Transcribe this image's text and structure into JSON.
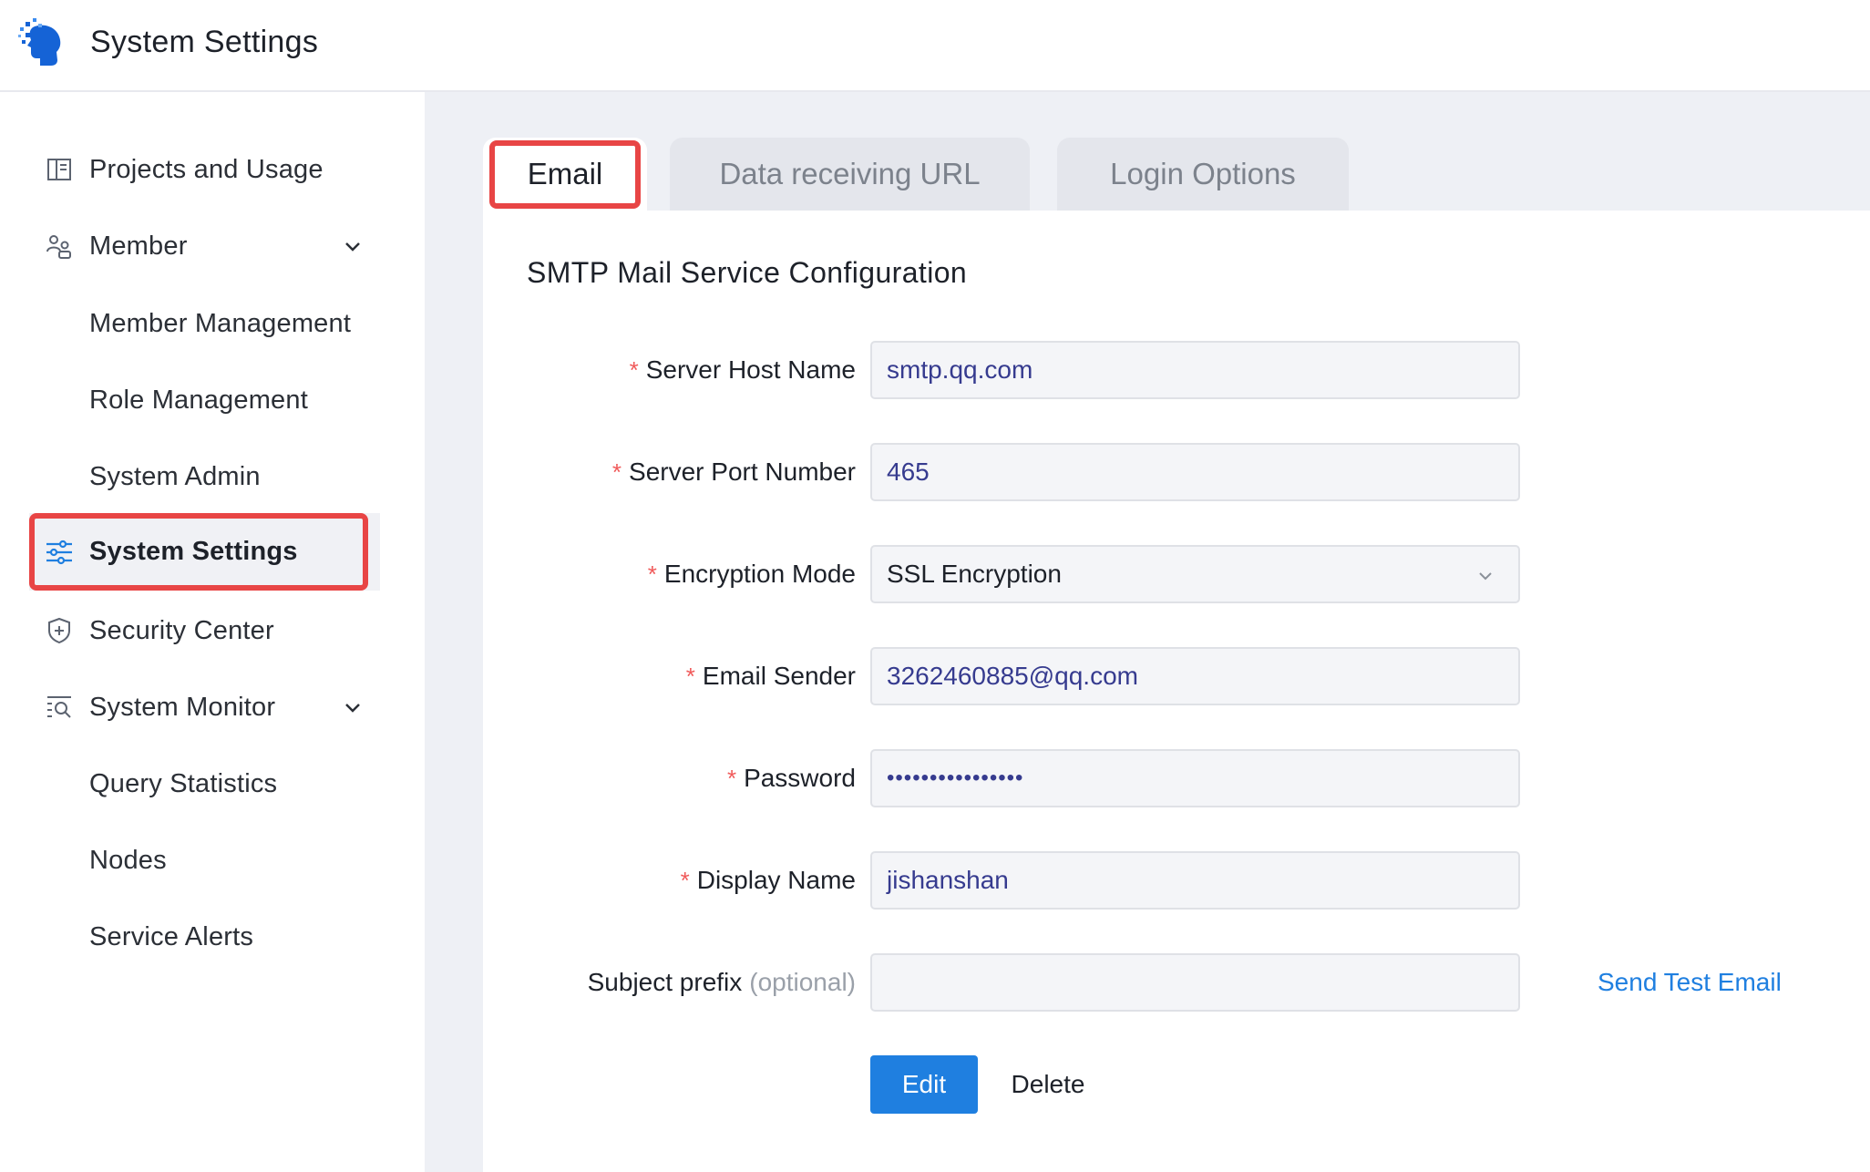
{
  "header": {
    "title": "System Settings",
    "logo_icon": "brain-head-logo"
  },
  "sidebar": {
    "items": [
      {
        "label": "Projects and Usage",
        "icon": "dashboard-icon"
      },
      {
        "label": "Member",
        "icon": "members-icon",
        "expandable": true
      },
      {
        "label": "Member Management"
      },
      {
        "label": "Role Management"
      },
      {
        "label": "System Admin"
      },
      {
        "label": "System Settings",
        "icon": "sliders-icon",
        "active": true
      },
      {
        "label": "Security Center",
        "icon": "shield-icon"
      },
      {
        "label": "System Monitor",
        "icon": "monitor-search-icon",
        "expandable": true
      },
      {
        "label": "Query Statistics"
      },
      {
        "label": "Nodes"
      },
      {
        "label": "Service Alerts"
      }
    ]
  },
  "tabs": [
    {
      "label": "Email",
      "active": true
    },
    {
      "label": "Data receiving URL"
    },
    {
      "label": "Login Options"
    }
  ],
  "form": {
    "title": "SMTP Mail Service Configuration",
    "required_mark": "*",
    "fields": {
      "host": {
        "label": "Server Host Name",
        "value": "smtp.qq.com"
      },
      "port": {
        "label": "Server Port Number",
        "value": "465"
      },
      "encryption": {
        "label": "Encryption Mode",
        "value": "SSL Encryption"
      },
      "sender": {
        "label": "Email Sender",
        "value": "3262460885@qq.com"
      },
      "password": {
        "label": "Password",
        "value": "••••••••••••••••"
      },
      "display_name": {
        "label": "Display Name",
        "value": "jishanshan"
      },
      "subject_prefix": {
        "label": "Subject prefix",
        "optional": "(optional)",
        "value": ""
      }
    },
    "send_test_label": "Send Test Email",
    "edit_label": "Edit",
    "delete_label": "Delete"
  },
  "colors": {
    "accent": "#1f7fe0",
    "highlight_frame": "#e84545",
    "required": "#f05a5a",
    "input_text": "#363b8f",
    "main_bg": "#eef0f5"
  }
}
